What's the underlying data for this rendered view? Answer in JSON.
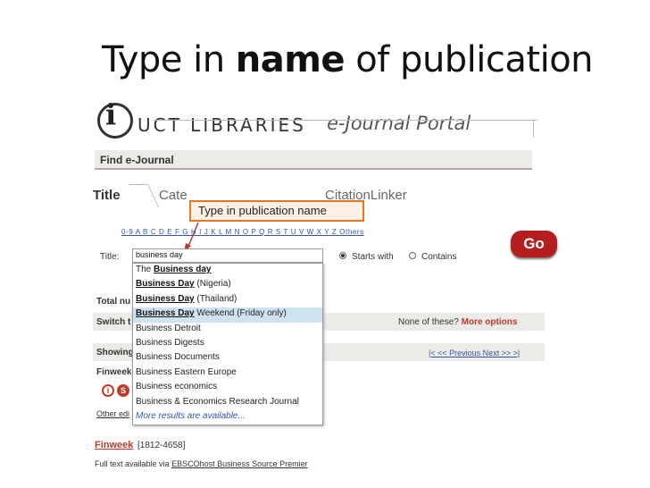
{
  "slide": {
    "title_before": "Type in",
    "title_bold": "name",
    "title_after": "of publication"
  },
  "header": {
    "logo_letter": "i",
    "logo_text": "UCT LIBRARIES",
    "portal_text": "e-Journal Portal"
  },
  "section": {
    "find_label": "Find e-Journal"
  },
  "tabs": {
    "title": "Title",
    "category": "Cate",
    "citation": "CitationLinker"
  },
  "callout": {
    "text": "Type in publication name"
  },
  "alpha": "0-9 A B C D E F G H I J K L M N O P Q R S T U V W X Y Z Others",
  "search": {
    "label": "Title:",
    "value": "business day",
    "starts_with": "Starts with",
    "contains": "Contains",
    "go_label": "Go"
  },
  "dropdown": {
    "items": [
      {
        "pre": "The ",
        "bold": "Business day",
        "post": "",
        "active": false
      },
      {
        "pre": "",
        "bold": "Business Day",
        "post": " (Nigeria)",
        "active": false
      },
      {
        "pre": "",
        "bold": "Business Day",
        "post": " (Thailand)",
        "active": false
      },
      {
        "pre": "",
        "bold": "Business Day",
        "post": " Weekend (Friday only)",
        "active": true
      },
      {
        "pre": "Business Detroit",
        "bold": "",
        "post": "",
        "active": false
      },
      {
        "pre": "Business Digests",
        "bold": "",
        "post": "",
        "active": false
      },
      {
        "pre": "Business Documents",
        "bold": "",
        "post": "",
        "active": false
      },
      {
        "pre": "Business Eastern Europe",
        "bold": "",
        "post": "",
        "active": false
      },
      {
        "pre": "Business economics",
        "bold": "",
        "post": "",
        "active": false
      },
      {
        "pre": "Business & Economics Research Journal",
        "bold": "",
        "post": "",
        "active": false
      }
    ],
    "more": "More results are available..."
  },
  "results": {
    "total_label": "Total nu",
    "switch_label": "Switch t",
    "none_text": "None of these?",
    "more_options": "More options",
    "showing_label": "Showing",
    "pager": "|<  << Previous  Next >>  >|",
    "finweek_short": "Finweek",
    "other_label": "Other edi",
    "icon_i": "i",
    "icon_s": "S",
    "finweek_link": "Finweek",
    "finweek_issn": "[1812-4658]",
    "fulltext_prefix": "Full text available via",
    "fulltext_source": "EBSCOhost Business Source Premier"
  }
}
